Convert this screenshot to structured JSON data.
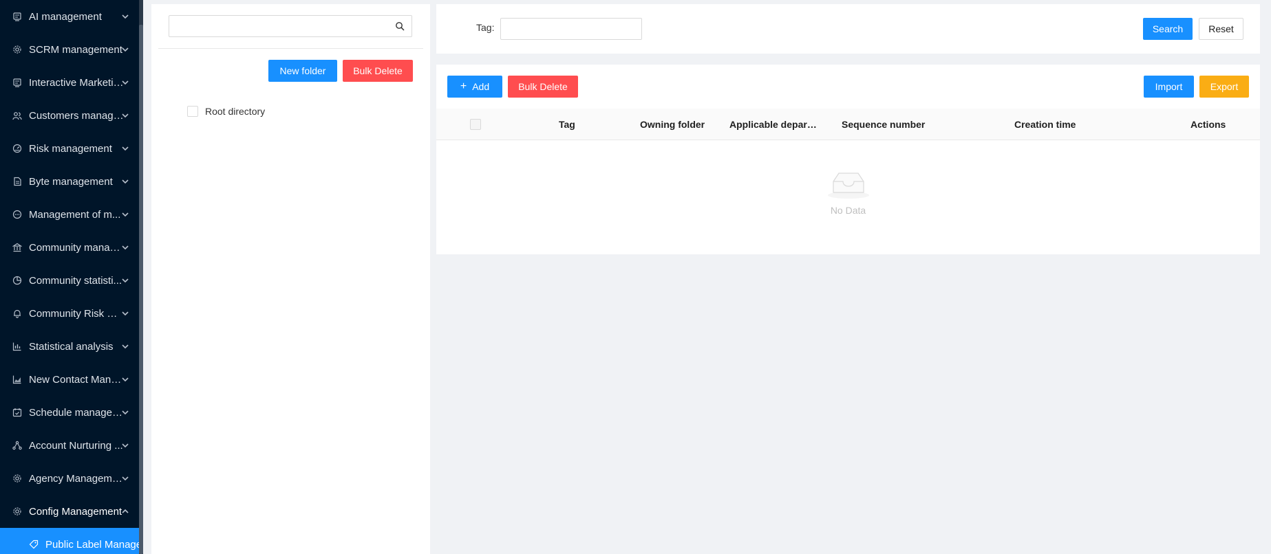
{
  "sidebar": {
    "items": [
      {
        "label": "AI management",
        "icon": "monitor-icon"
      },
      {
        "label": "SCRM management",
        "icon": "gear-icon"
      },
      {
        "label": "Interactive Marketing",
        "icon": "monitor-icon"
      },
      {
        "label": "Customers manage...",
        "icon": "users-icon"
      },
      {
        "label": "Risk management",
        "icon": "dashboard-icon"
      },
      {
        "label": "Byte management",
        "icon": "file-icon"
      },
      {
        "label": "Management of m...",
        "icon": "chat-icon"
      },
      {
        "label": "Community manag...",
        "icon": "bank-icon"
      },
      {
        "label": "Community statisti...",
        "icon": "pie-chart-icon"
      },
      {
        "label": "Community Risk Co...",
        "icon": "bell-icon"
      },
      {
        "label": "Statistical analysis",
        "icon": "bar-chart-icon"
      },
      {
        "label": "New Contact Mana...",
        "icon": "area-chart-icon"
      },
      {
        "label": "Schedule managem...",
        "icon": "calendar-check-icon"
      },
      {
        "label": "Account Nurturing ...",
        "icon": "nodes-icon"
      },
      {
        "label": "Agency Management",
        "icon": "gear-icon"
      },
      {
        "label": "Config Management",
        "icon": "gear-icon"
      }
    ],
    "sub_item": {
      "label": "Public Label Management",
      "icon": "tag-icon"
    }
  },
  "folder_panel": {
    "search_placeholder": "",
    "new_folder_label": "New folder",
    "bulk_delete_label": "Bulk Delete",
    "root_label": "Root directory"
  },
  "filter": {
    "tag_label": "Tag:",
    "tag_value": "",
    "search_label": "Search",
    "reset_label": "Reset"
  },
  "toolbar": {
    "add_label": "Add",
    "bulk_delete_label": "Bulk Delete",
    "import_label": "Import",
    "export_label": "Export"
  },
  "table": {
    "columns": [
      "Tag",
      "Owning folder",
      "Applicable depart...",
      "Sequence number",
      "Creation time",
      "Actions"
    ],
    "empty_text": "No Data"
  },
  "colors": {
    "sidebar_bg": "#001529",
    "primary": "#1890ff",
    "danger": "#ff4d4f",
    "warning": "#faad14"
  }
}
